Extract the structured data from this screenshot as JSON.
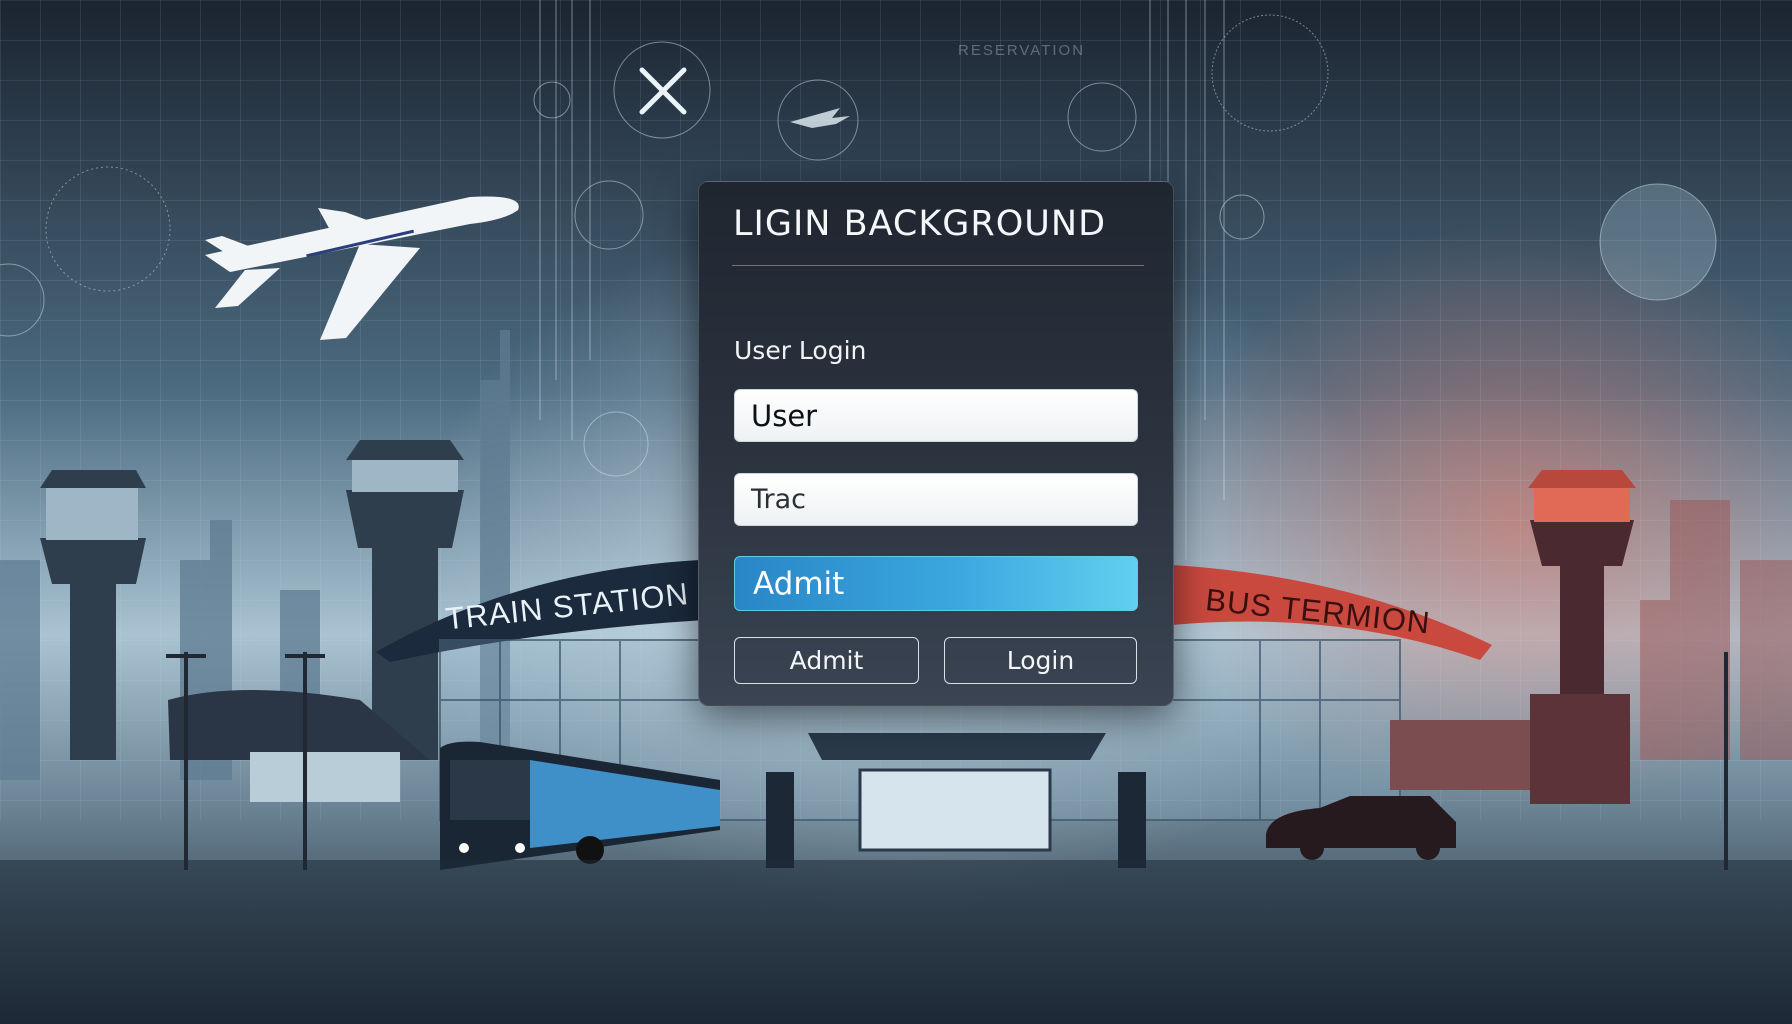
{
  "background": {
    "reservation_text": "RESERVATION",
    "train_station_sign": "TRAIN STATION",
    "bus_terminal_sign": "BUS TERMION"
  },
  "login_panel": {
    "title": "LIGIN BACKGROUND",
    "section_label": "User Login",
    "username_value": "User",
    "password_value": "Trac",
    "primary_button_label": "Admit",
    "admit_button_label": "Admit",
    "login_button_label": "Login"
  },
  "colors": {
    "accent_blue": "#3aa7df",
    "panel_dark": "#252d38",
    "warm_glow": "#e8786a"
  }
}
